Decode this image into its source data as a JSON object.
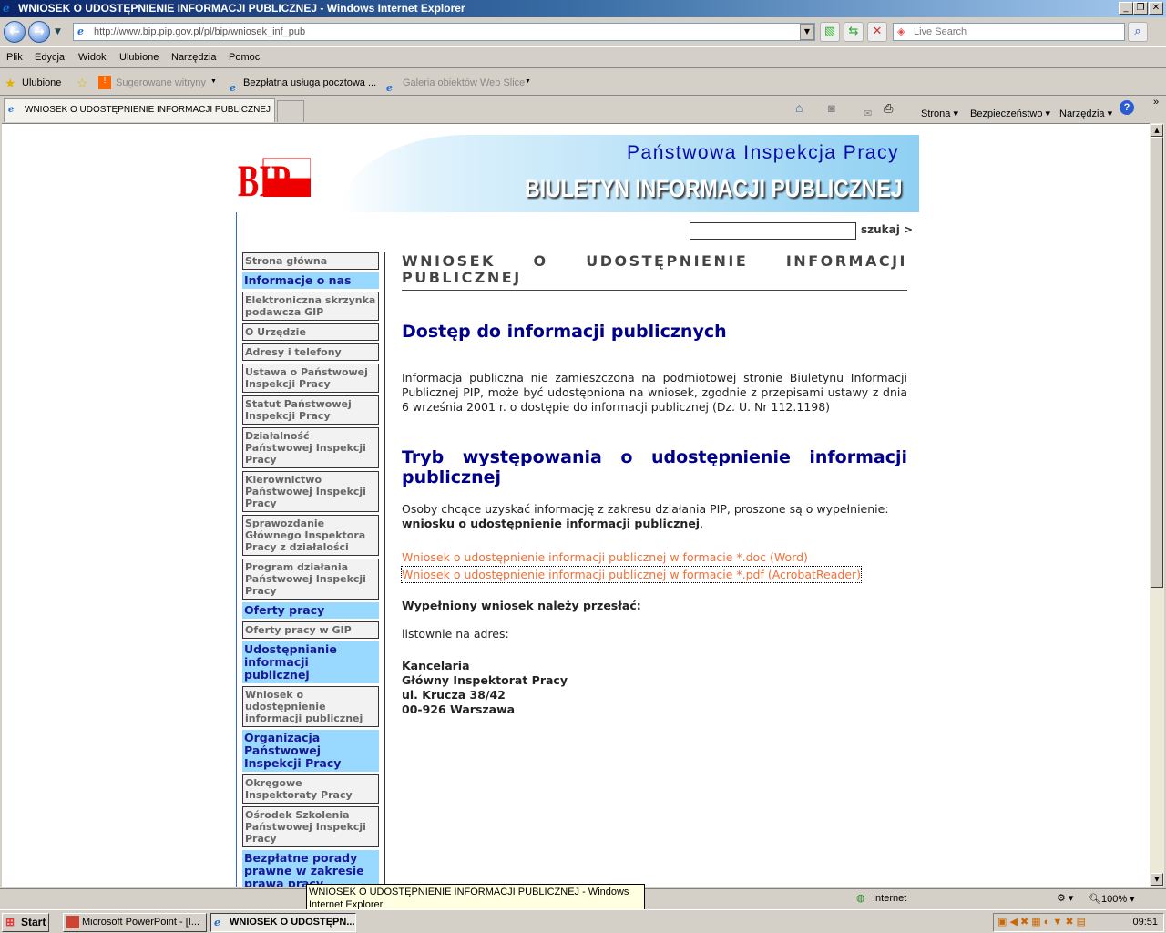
{
  "window": {
    "title": "WNIOSEK O UDOSTĘPNIENIE INFORMACJI PUBLICZNEJ - Windows Internet Explorer"
  },
  "address": {
    "url": "http://www.bip.pip.gov.pl/pl/bip/wniosek_inf_pub",
    "search_placeholder": "Live Search"
  },
  "menu": [
    "Plik",
    "Edycja",
    "Widok",
    "Ulubione",
    "Narzędzia",
    "Pomoc"
  ],
  "favorites": {
    "label": "Ulubione",
    "items": [
      "Sugerowane witryny",
      "Bezpłatna usługa pocztowa ...",
      "Galeria obiektów Web Slice"
    ]
  },
  "tab": {
    "label": "WNIOSEK O UDOSTĘPNIENIE INFORMACJI PUBLICZNEJ"
  },
  "commands": [
    "Strona",
    "Bezpieczeństwo",
    "Narzędzia"
  ],
  "banner": {
    "line1": "Państwowa Inspekcja Pracy",
    "line2": "BIULETYN INFORMACJI PUBLICZNEJ",
    "logo": "BIP"
  },
  "search": {
    "button": "szukaj >",
    "value": ""
  },
  "sidebar": [
    {
      "type": "item",
      "label": "Strona główna"
    },
    {
      "type": "section",
      "label": "Informacje o nas"
    },
    {
      "type": "item",
      "label": "Elektroniczna skrzynka podawcza GIP"
    },
    {
      "type": "item",
      "label": "O Urzędzie"
    },
    {
      "type": "item",
      "label": "Adresy i telefony"
    },
    {
      "type": "item",
      "label": "Ustawa o Państwowej Inspekcji Pracy"
    },
    {
      "type": "item",
      "label": "Statut Państwowej Inspekcji Pracy"
    },
    {
      "type": "item",
      "label": "Działalność Państwowej Inspekcji Pracy"
    },
    {
      "type": "item",
      "label": "Kierownictwo Państwowej Inspekcji Pracy"
    },
    {
      "type": "item",
      "label": "Sprawozdanie Głównego Inspektora Pracy z działalości"
    },
    {
      "type": "item",
      "label": "Program działania Państwowej Inspekcji Pracy"
    },
    {
      "type": "section",
      "label": "Oferty pracy"
    },
    {
      "type": "item",
      "label": "Oferty pracy w GIP"
    },
    {
      "type": "section",
      "label": "Udostępnianie informacji publicznej"
    },
    {
      "type": "item",
      "label": "Wniosek o udostępnienie informacji publicznej"
    },
    {
      "type": "section",
      "label": "Organizacja Państwowej Inspekcji Pracy"
    },
    {
      "type": "item",
      "label": "Okręgowe Inspektoraty Pracy"
    },
    {
      "type": "item",
      "label": "Ośrodek Szkolenia Państwowej Inspekcji Pracy"
    },
    {
      "type": "section",
      "label": "Bezpłatne porady prawne w zakresie prawa pracy"
    }
  ],
  "main": {
    "title": "WNIOSEK O UDOSTĘPNIENIE INFORMACJI PUBLICZNEJ",
    "h1": "Dostęp do informacji publicznych",
    "p1": "Informacja publiczna nie zamieszczona na podmiotowej stronie Biuletynu Informacji Publicznej PIP, może być udostępniona na wniosek, zgodnie z przepisami ustawy z dnia 6 września 2001 r. o dostępie do informacji publicznej (Dz. U. Nr 112.1198)",
    "h2": "Tryb występowania o udostępnienie informacji publicznej",
    "p2": "Osoby chcące uzyskać informację z zakresu działania PIP, proszone są o wypełnienie:",
    "p2_bold": "wniosku o udostępnienie informacji publicznej",
    "p2_end": ".",
    "link_doc": "Wniosek o udostępnienie informacji publicznej w formacie *.doc (Word)",
    "link_pdf": "Wniosek o udostępnienie informacji publicznej w formacie *.pdf (AcrobatReader)",
    "send": "Wypełniony wniosek należy przesłać:",
    "post": "listownie na adres:",
    "address": [
      "Kancelaria",
      "Główny Inspektorat Pracy",
      "ul. Krucza 38/42",
      "00-926 Warszawa"
    ]
  },
  "tooltip": "WNIOSEK O UDOSTĘPNIENIE INFORMACJI PUBLICZNEJ - Windows Internet Explorer",
  "status": {
    "zone": "Internet",
    "zoom": "100%"
  },
  "taskbar": {
    "start": "Start",
    "items": [
      "Microsoft PowerPoint - [I...",
      "WNIOSEK O UDOSTĘPN..."
    ],
    "clock": "09:51"
  },
  "colors": {
    "section_bg": "#99d9ff",
    "section_text": "#1a1a99",
    "heading": "#00008b",
    "link": "#f36f36"
  }
}
